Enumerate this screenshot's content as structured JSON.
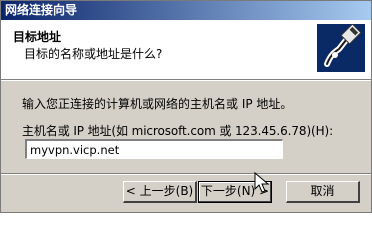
{
  "window": {
    "title": "网络连接向导"
  },
  "header": {
    "title": "目标地址",
    "subtitle": "目标的名称或地址是什么?",
    "icon": "network-cable-icon"
  },
  "main": {
    "instruction": "输入您正连接的计算机或网络的主机名或 IP 地址。",
    "field_label": "主机名或 IP 地址(如 microsoft.com 或 123.45.6.78)(H):",
    "field_value": "myvpn.vicp.net"
  },
  "buttons": {
    "back": "< 上一步(B)",
    "next": "下一步(N) >",
    "cancel": "取消"
  }
}
